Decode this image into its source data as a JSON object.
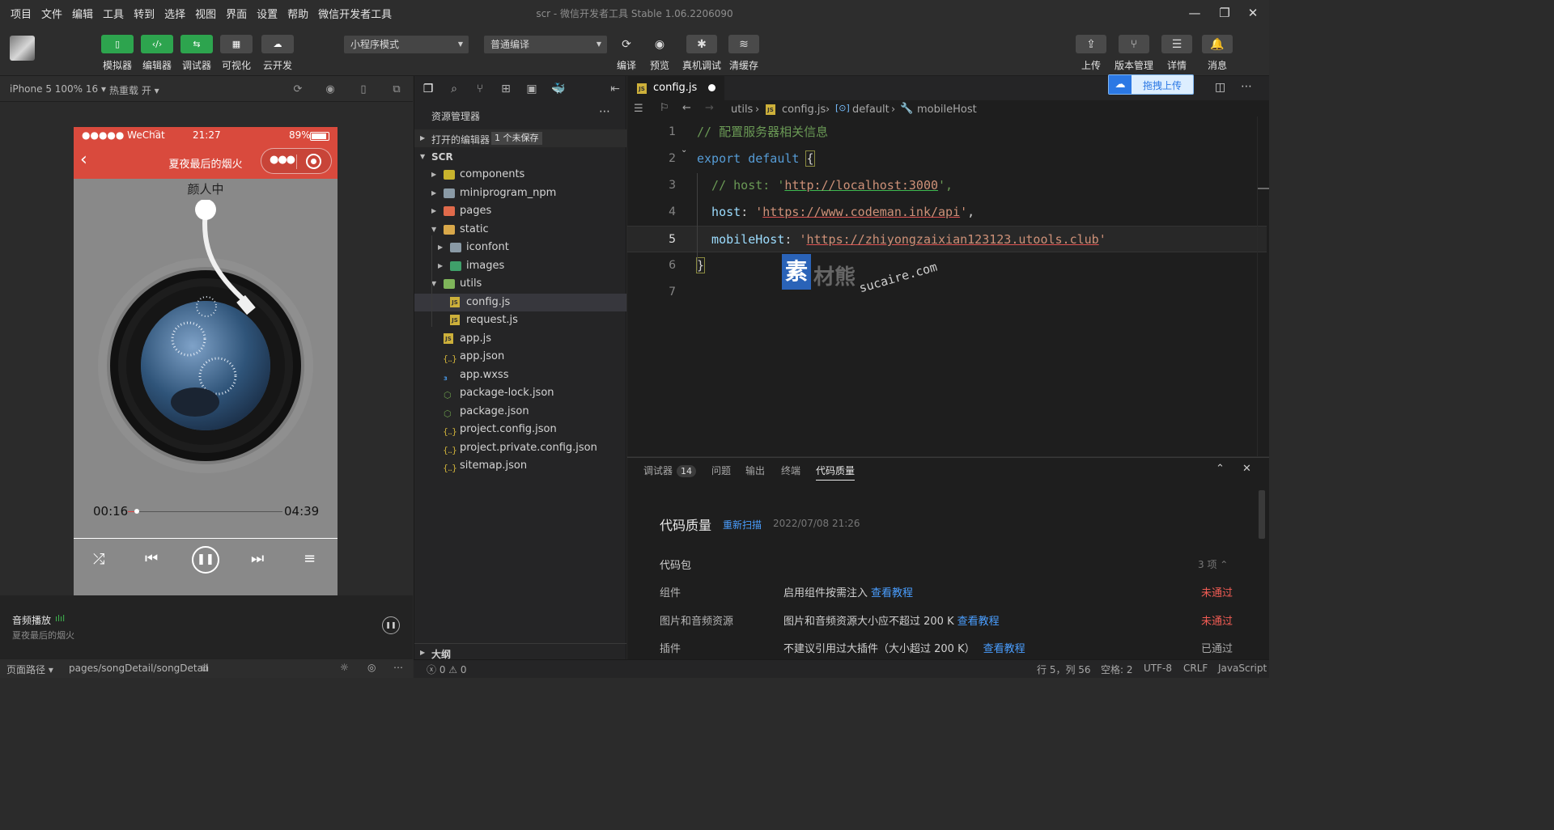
{
  "menubar": {
    "items": [
      "项目",
      "文件",
      "编辑",
      "工具",
      "转到",
      "选择",
      "视图",
      "界面",
      "设置",
      "帮助",
      "微信开发者工具"
    ],
    "title": "scr - 微信开发者工具 Stable 1.06.2206090"
  },
  "toolbar": {
    "left_buttons": [
      {
        "label": "模拟器",
        "icon": "phone-icon",
        "style": "green"
      },
      {
        "label": "编辑器",
        "icon": "code-icon",
        "style": "green"
      },
      {
        "label": "调试器",
        "icon": "debug-icon",
        "style": "green"
      },
      {
        "label": "可视化",
        "icon": "layout-icon",
        "style": "gray"
      },
      {
        "label": "云开发",
        "icon": "cloud-icon",
        "style": "gray"
      }
    ],
    "mode_select": "小程序模式",
    "compile_select": "普通编译",
    "mid_buttons": [
      {
        "label": "编译",
        "icon": "refresh-icon"
      },
      {
        "label": "预览",
        "icon": "eye-icon"
      },
      {
        "label": "真机调试",
        "icon": "bug-icon"
      },
      {
        "label": "清缓存",
        "icon": "layers-icon"
      }
    ],
    "right_buttons": [
      {
        "label": "上传",
        "icon": "upload-icon"
      },
      {
        "label": "版本管理",
        "icon": "branch-icon"
      },
      {
        "label": "详情",
        "icon": "menu-icon"
      },
      {
        "label": "消息",
        "icon": "bell-icon"
      }
    ]
  },
  "simulator": {
    "device": "iPhone 5 100% 16",
    "hot_reload": "热重载 开",
    "status": {
      "signal": "●●●●● WeChat",
      "time": "21:27",
      "battery": "89%"
    },
    "nav_title": "夏夜最后的烟火",
    "artist": "颜人中",
    "current_time": "00:16",
    "total_time": "04:39",
    "progress": 0.057,
    "audio_panel": {
      "title": "音频播放",
      "subtitle": "夏夜最后的烟火"
    },
    "page_path_label": "页面路径",
    "page_path": "pages/songDetail/songDetail"
  },
  "explorer": {
    "title": "资源管理器",
    "open_editors": "打开的编辑器",
    "unsaved_badge": "1 个未保存",
    "root": "SCR",
    "tree": [
      {
        "name": "components",
        "kind": "folder",
        "depth": 1,
        "color": "#c9b42d"
      },
      {
        "name": "miniprogram_npm",
        "kind": "folder",
        "depth": 1,
        "color": "#8a9aa6"
      },
      {
        "name": "pages",
        "kind": "folder",
        "depth": 1,
        "color": "#e06a4b"
      },
      {
        "name": "static",
        "kind": "folder-open",
        "depth": 1,
        "color": "#d9a84a"
      },
      {
        "name": "iconfont",
        "kind": "folder",
        "depth": 2,
        "color": "#8a9aa6"
      },
      {
        "name": "images",
        "kind": "folder",
        "depth": 2,
        "color": "#3fa06a"
      },
      {
        "name": "utils",
        "kind": "folder-open",
        "depth": 1,
        "color": "#7fb55a"
      },
      {
        "name": "config.js",
        "kind": "js",
        "depth": 2
      },
      {
        "name": "request.js",
        "kind": "js",
        "depth": 2
      },
      {
        "name": "app.js",
        "kind": "js",
        "depth": 1
      },
      {
        "name": "app.json",
        "kind": "json",
        "depth": 1
      },
      {
        "name": "app.wxss",
        "kind": "css",
        "depth": 1
      },
      {
        "name": "package-lock.json",
        "kind": "npm",
        "depth": 1
      },
      {
        "name": "package.json",
        "kind": "npm",
        "depth": 1
      },
      {
        "name": "project.config.json",
        "kind": "json",
        "depth": 1
      },
      {
        "name": "project.private.config.json",
        "kind": "json",
        "depth": 1
      },
      {
        "name": "sitemap.json",
        "kind": "json",
        "depth": 1
      }
    ],
    "outline": "大纲",
    "errors": "0",
    "warnings": "0"
  },
  "editor": {
    "tab": "config.js",
    "breadcrumb": [
      "utils",
      "config.js",
      "default",
      "mobileHost"
    ],
    "upload_float": "拖拽上传",
    "lines": [
      {
        "n": "1",
        "parts": [
          [
            "cmt",
            "// 配置服务器相关信息"
          ]
        ]
      },
      {
        "n": "2",
        "parts": [
          [
            "kw",
            "export default "
          ],
          [
            "brace",
            "{"
          ]
        ]
      },
      {
        "n": "3",
        "parts": [
          [
            "cmt",
            "  // host: '"
          ],
          [
            "url-g",
            "http://localhost:3000"
          ],
          [
            "cmt",
            "',"
          ]
        ]
      },
      {
        "n": "4",
        "parts": [
          [
            "prop",
            "  host"
          ],
          [
            "plain",
            ": "
          ],
          [
            "str",
            "'"
          ],
          [
            "url-r",
            "https://www.codeman.ink/api"
          ],
          [
            "str",
            "'"
          ],
          [
            "plain",
            ","
          ]
        ]
      },
      {
        "n": "5",
        "parts": [
          [
            "prop",
            "  mobileHost"
          ],
          [
            "plain",
            ": "
          ],
          [
            "str",
            "'"
          ],
          [
            "url-r",
            "https://zhiyongzaixian123123.utools.club"
          ],
          [
            "str",
            "'"
          ]
        ]
      },
      {
        "n": "6",
        "parts": [
          [
            "brace",
            "}"
          ]
        ]
      },
      {
        "n": "7",
        "parts": []
      }
    ]
  },
  "watermark": {
    "main": "素材熊",
    "sub": "sucaire.com"
  },
  "panel": {
    "tabs": [
      {
        "label": "调试器",
        "badge": "14"
      },
      {
        "label": "问题"
      },
      {
        "label": "输出"
      },
      {
        "label": "终端"
      },
      {
        "label": "代码质量"
      }
    ],
    "title": "代码质量",
    "rescan": "重新扫描",
    "date": "2022/07/08 21:26",
    "section": "代码包",
    "section_count": "3 项",
    "rows": [
      {
        "name": "组件",
        "desc": "启用组件按需注入",
        "link": "查看教程",
        "status": "未通过",
        "status_color": "#f25c54"
      },
      {
        "name": "图片和音频资源",
        "desc": "图片和音频资源大小应不超过 200 K",
        "link": "查看教程",
        "status": "未通过",
        "status_color": "#f25c54"
      },
      {
        "name": "插件",
        "desc": "不建议引用过大插件（大小超过 200 K）",
        "link": "查看教程",
        "status": "已通过",
        "status_color": "#a8a8a8"
      }
    ]
  },
  "statusbar": {
    "position": "行 5，列 56",
    "spaces": "空格: 2",
    "encoding": "UTF-8",
    "eol": "CRLF",
    "language": "JavaScript"
  }
}
